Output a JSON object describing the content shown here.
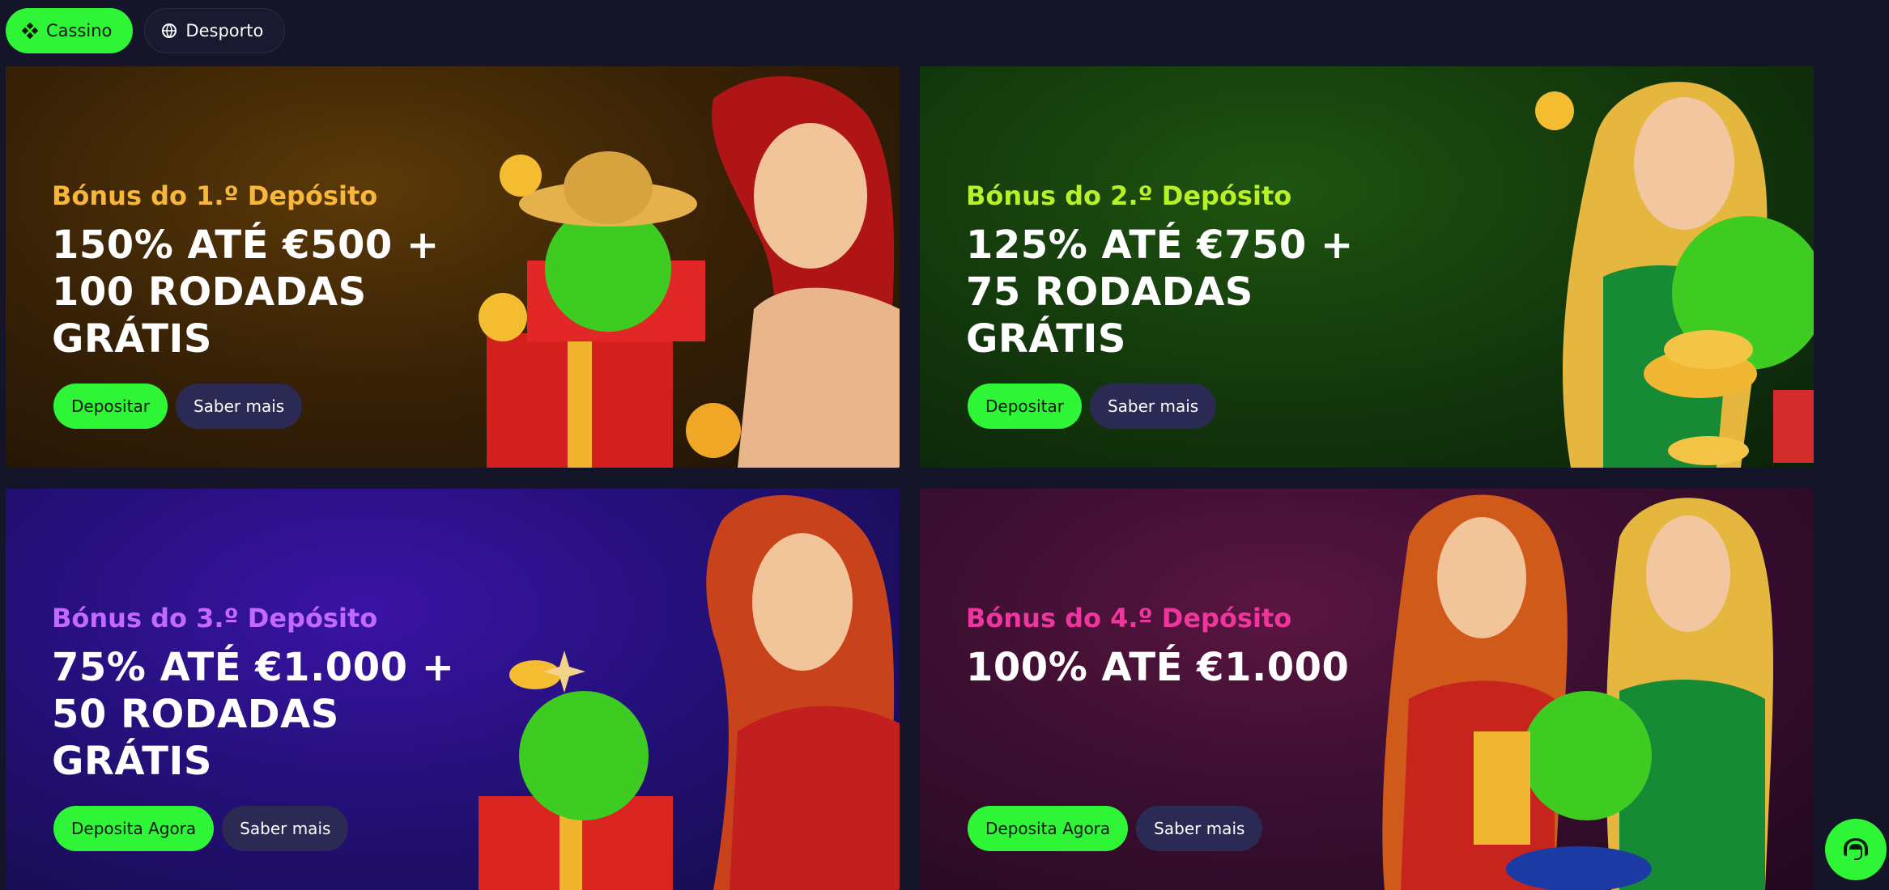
{
  "tabs": [
    {
      "label": "Cassino",
      "icon": "cards-icon",
      "active": true
    },
    {
      "label": "Desporto",
      "icon": "ball-icon",
      "active": false
    }
  ],
  "cards": [
    {
      "subtitle": "Bónus do 1.º Depósito",
      "title": "150% ATÉ €500 + 100 RODADAS GRÁTIS",
      "primary": "Depositar",
      "secondary": "Saber mais",
      "accent": "#f6b73c"
    },
    {
      "subtitle": "Bónus do 2.º Depósito",
      "title": "125% ATÉ €750 + 75 RODADAS GRÁTIS",
      "primary": "Depositar",
      "secondary": "Saber mais",
      "accent": "#b8f12a"
    },
    {
      "subtitle": "Bónus do 3.º Depósito",
      "title": "75% ATÉ €1.000 + 50 RODADAS GRÁTIS",
      "primary": "Deposita Agora",
      "secondary": "Saber mais",
      "accent": "#c369ff"
    },
    {
      "subtitle": "Bónus do 4.º Depósito",
      "title": "100% ATÉ €1.000",
      "primary": "Deposita Agora",
      "secondary": "Saber mais",
      "accent": "#f0369e"
    }
  ],
  "colors": {
    "green": "#2ef536",
    "page_bg": "#15152a"
  },
  "chat": {
    "icon": "chat-icon"
  }
}
